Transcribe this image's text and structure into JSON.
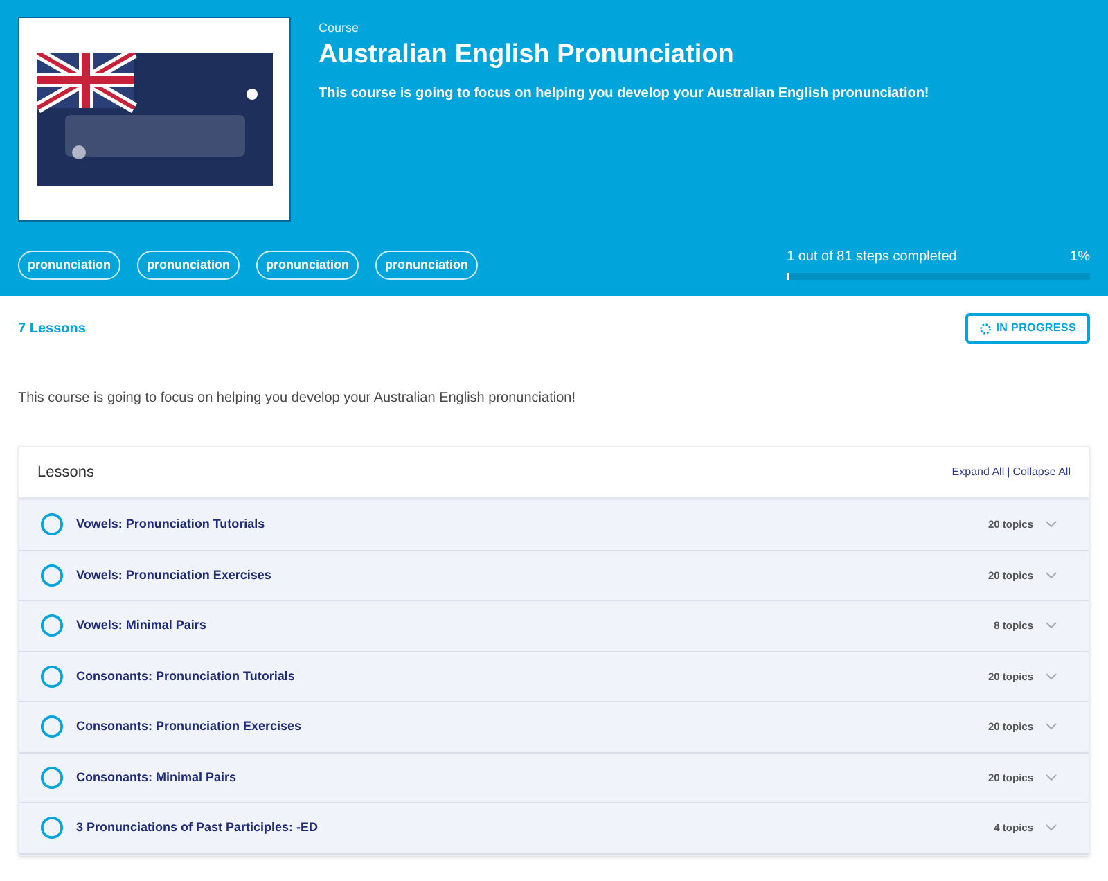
{
  "header": {
    "label": "Course",
    "title": "Australian English Pronunciation",
    "description": "This course is going to focus on helping you develop your Australian English pronunciation!",
    "tags": [
      "pronunciation",
      "pronunciation",
      "pronunciation",
      "pronunciation"
    ],
    "progress": {
      "text": "1 out of 81 steps completed",
      "percent": "1%",
      "level": 0.01
    }
  },
  "summary": {
    "lesson_count": "7 Lessons",
    "status": "IN PROGRESS"
  },
  "description": "This course is going to focus on helping you develop your Australian English pronunciation!",
  "lessons": {
    "heading": "Lessons",
    "expand": "Expand All",
    "separator": "|",
    "collapse": "Collapse All",
    "items": [
      {
        "title": "Vowels: Pronunciation Tutorials",
        "topics": "20 topics",
        "completed": false
      },
      {
        "title": "Vowels: Pronunciation Exercises",
        "topics": "20 topics",
        "completed": false
      },
      {
        "title": "Vowels: Minimal Pairs",
        "topics": "8 topics",
        "completed": false
      },
      {
        "title": "Consonants: Pronunciation Tutorials",
        "topics": "20 topics",
        "completed": false
      },
      {
        "title": "Consonants: Pronunciation Exercises",
        "topics": "20 topics",
        "completed": false
      },
      {
        "title": "Consonants: Minimal Pairs",
        "topics": "20 topics",
        "completed": false
      },
      {
        "title": "3 Pronunciations of Past Participles: -ED",
        "topics": "4 topics",
        "completed": false
      }
    ]
  }
}
